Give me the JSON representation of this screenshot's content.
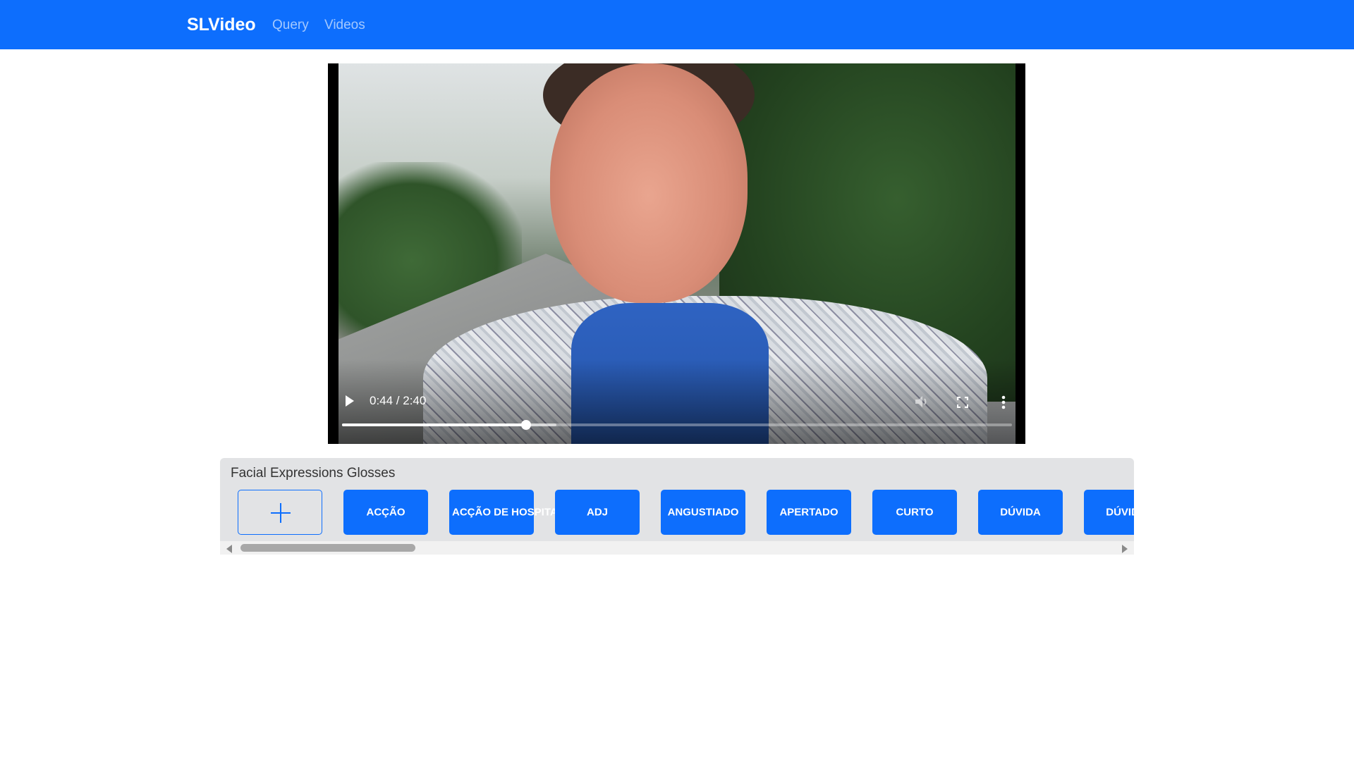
{
  "navbar": {
    "brand": "SLVideo",
    "links": [
      {
        "label": "Query"
      },
      {
        "label": "Videos"
      }
    ],
    "bg_color": "#0d6efd"
  },
  "video_player": {
    "current_time": "0:44",
    "duration": "2:40",
    "time_display": "0:44 / 2:40",
    "progress_fraction": 0.275,
    "buffered_fraction": 0.32,
    "icons": [
      "play-icon",
      "volume-icon",
      "fullscreen-icon",
      "more-options-icon"
    ]
  },
  "glosses_panel": {
    "title": "Facial Expressions Glosses",
    "add_icon": "plus-icon",
    "items": [
      {
        "label": "ACÇÃO"
      },
      {
        "label": "ACÇÃO DE HOSPITALIZAR"
      },
      {
        "label": "ADJ"
      },
      {
        "label": "ANGUSTIADO"
      },
      {
        "label": "APERTADO"
      },
      {
        "label": "CURTO"
      },
      {
        "label": "DÚVIDA"
      },
      {
        "label": "DÚVIDA"
      }
    ],
    "button_color": "#0d6efd"
  }
}
